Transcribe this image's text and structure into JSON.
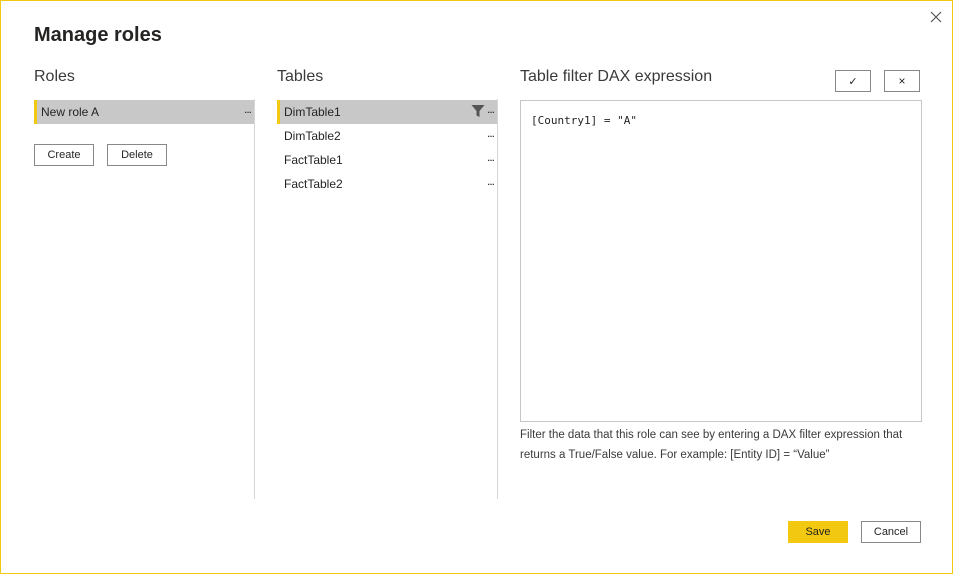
{
  "dialog": {
    "title": "Manage roles"
  },
  "roles": {
    "header": "Roles",
    "items": [
      {
        "label": "New role A",
        "more": "..."
      }
    ],
    "create_label": "Create",
    "delete_label": "Delete"
  },
  "tables": {
    "header": "Tables",
    "items": [
      {
        "label": "DimTable1",
        "more": "...",
        "filtered": true
      },
      {
        "label": "DimTable2",
        "more": "..."
      },
      {
        "label": "FactTable1",
        "more": "..."
      },
      {
        "label": "FactTable2",
        "more": "..."
      }
    ]
  },
  "dax": {
    "header": "Table filter DAX expression",
    "accept_icon": "✓",
    "cancel_icon": "×",
    "expression": "[Country1] = \"A\"",
    "hint": "Filter the data that this role can see by entering a DAX filter expression that returns a True/False value. For example: [Entity ID] = “Value”"
  },
  "footer": {
    "save_label": "Save",
    "cancel_label": "Cancel"
  },
  "colors": {
    "accent": "#F2C811",
    "selected_row": "#C8C8C8"
  }
}
